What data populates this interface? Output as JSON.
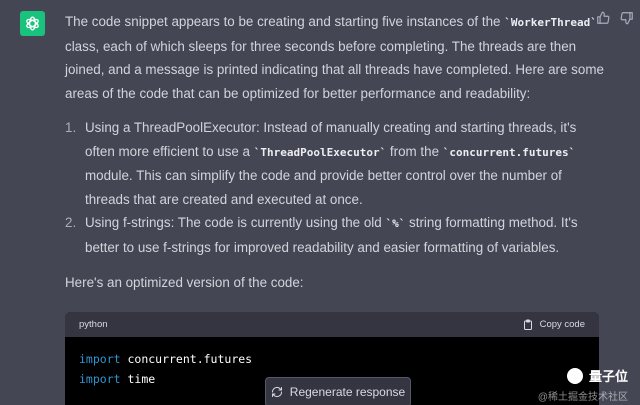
{
  "avatar": {
    "icon": "openai-logo-icon",
    "bg_color": "#19c37d"
  },
  "message": {
    "para1": {
      "t1": "The code snippet appears to be creating and starting five instances of the ",
      "code1": "`WorkerThread`",
      "t2": " class, each of which sleeps for three seconds before completing. The threads are then joined, and a message is printed indicating that all threads have completed. Here are some areas of the code that can be optimized for better performance and readability:"
    },
    "items": [
      {
        "num": "1.",
        "t1": "Using a ThreadPoolExecutor: Instead of manually creating and starting threads, it's often more efficient to use a ",
        "code1": "`ThreadPoolExecutor`",
        "t2": " from the ",
        "code2": "`concurrent.futures`",
        "t3": " module. This can simplify the code and provide better control over the number of threads that are created and executed at once."
      },
      {
        "num": "2.",
        "t1": "Using f-strings: The code is currently using the old ",
        "code1": "`%`",
        "t2": " string formatting method. It's better to use f-strings for improved readability and easier formatting of variables."
      }
    ],
    "para2": "Here's an optimized version of the code:"
  },
  "codeblock": {
    "language": "python",
    "copy_label": "Copy code",
    "lines": [
      {
        "keyword": "import",
        "rest": " concurrent.futures"
      },
      {
        "keyword": "import",
        "rest": " time"
      }
    ]
  },
  "regenerate_label": "Regenerate response",
  "watermark": {
    "title": "量子位",
    "sub": "@稀土掘金技术社区"
  }
}
